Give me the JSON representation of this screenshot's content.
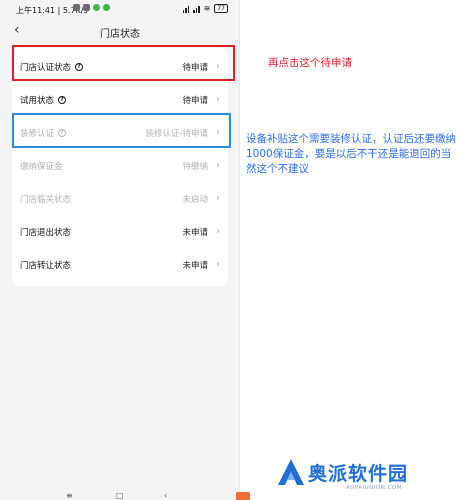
{
  "status_bar": {
    "time_speed": "上午11:41 | 5.7K/s",
    "battery": "77"
  },
  "nav": {
    "back_icon": "chevron-left-icon",
    "title": "门店状态"
  },
  "rows": [
    {
      "label": "门店认证状态",
      "has_help": true,
      "value": "待申请",
      "disabled": false
    },
    {
      "label": "试用状态",
      "has_help": true,
      "value": "待申请",
      "disabled": false
    },
    {
      "label": "装修认证",
      "has_help": true,
      "value": "装修认证-待申请",
      "disabled": true
    },
    {
      "label": "缴纳保证金",
      "has_help": false,
      "value": "待缴纳",
      "disabled": true
    },
    {
      "label": "门店临关状态",
      "has_help": false,
      "value": "未启动",
      "disabled": true
    },
    {
      "label": "门店退出状态",
      "has_help": false,
      "value": "未申请",
      "disabled": false
    },
    {
      "label": "门店转让状态",
      "has_help": false,
      "value": "未申请",
      "disabled": false
    }
  ],
  "annotations": {
    "red_note": "再点击这个待申请",
    "blue_note": "设备补贴这个需要装修认证，认证后还要缴纳1000保证金，要是以后不干还是能退回的当然这个不建议"
  },
  "watermark": {
    "name": "奥派软件园",
    "sub": "AUPAIUNION.COM"
  },
  "colors": {
    "highlight_red": "#e11d2a",
    "highlight_blue": "#2d8ce0",
    "watermark_blue": "#1f6fd6"
  }
}
